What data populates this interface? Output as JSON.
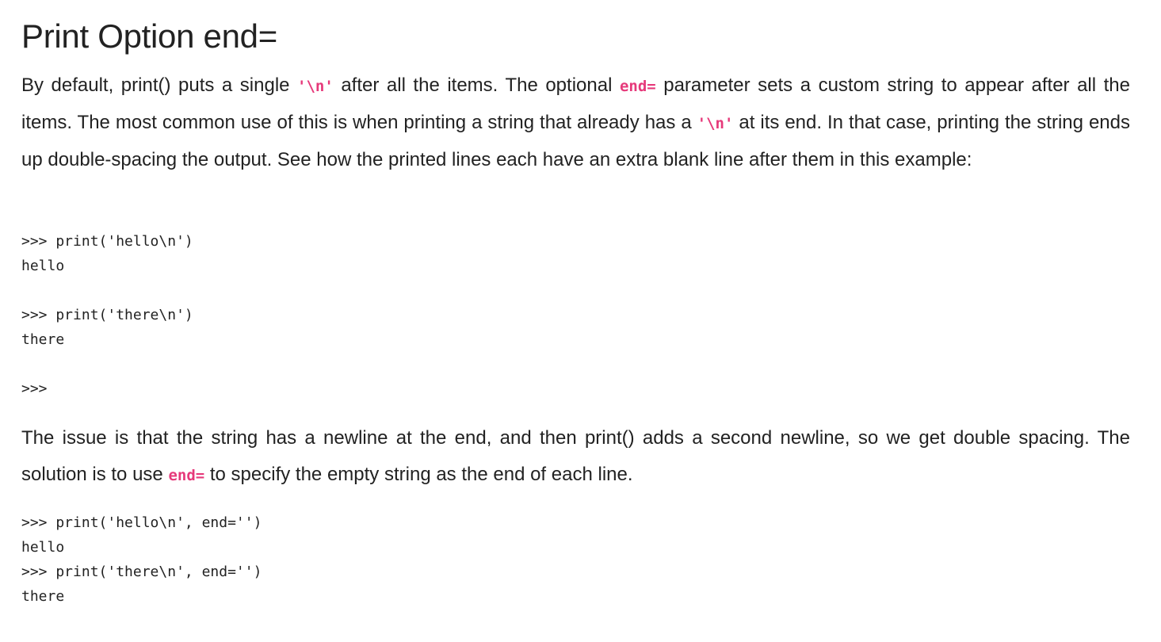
{
  "heading": "Print Option end=",
  "para1": {
    "t1": "By default, print() puts a single ",
    "c1": "'\\n'",
    "t2": " after all the items. The optional ",
    "c2": "end=",
    "t3": " parameter sets a custom string to appear after all the items. The most common use of this is when printing a string that already has a ",
    "c3": "'\\n'",
    "t4": " at its end. In that case, printing the string ends up double-spacing the output. See how the printed lines each have an extra blank line after them in this example:"
  },
  "code1": [
    ">>> print('hello\\n')",
    "hello",
    "",
    ">>> print('there\\n')",
    "there",
    "",
    ">>>"
  ],
  "para2": {
    "t1": "The issue is that the string has a newline at the end, and then print() adds a second newline, so we get double spacing. The solution is to use ",
    "c1": "end=",
    "t2": " to specify the empty string as the end of each line."
  },
  "code2": [
    ">>> print('hello\\n', end='')",
    "hello",
    ">>> print('there\\n', end='')",
    "there"
  ]
}
